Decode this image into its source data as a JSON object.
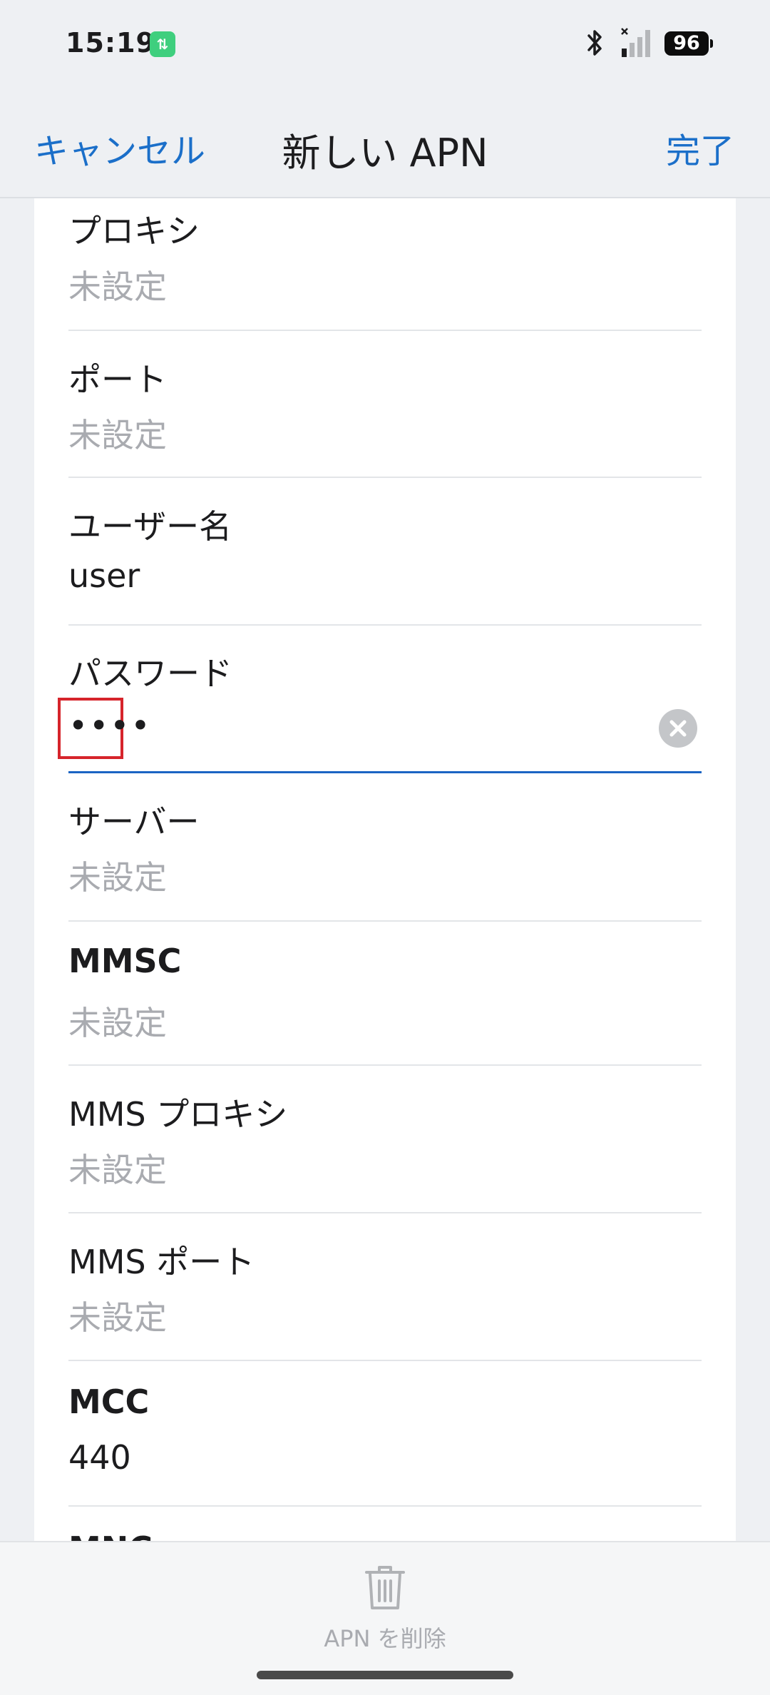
{
  "status_bar": {
    "time": "15:19",
    "network_badge": "⇅",
    "battery": "96"
  },
  "navbar": {
    "cancel_label": "キャンセル",
    "title": "新しい APN",
    "done_label": "完了"
  },
  "fields": [
    {
      "label": "プロキシ",
      "value": "未設定",
      "is_placeholder": true
    },
    {
      "label": "ポート",
      "value": "未設定",
      "is_placeholder": true
    },
    {
      "label": "ユーザー名",
      "value": "user",
      "is_placeholder": false
    },
    {
      "label": "パスワード",
      "value": "••••",
      "is_placeholder": false,
      "focused": true
    },
    {
      "label": "サーバー",
      "value": "未設定",
      "is_placeholder": true
    },
    {
      "label": "MMSC",
      "value": "未設定",
      "is_placeholder": true
    },
    {
      "label": "MMS プロキシ",
      "value": "未設定",
      "is_placeholder": true
    },
    {
      "label": "MMS ポート",
      "value": "未設定",
      "is_placeholder": true
    },
    {
      "label": "MCC",
      "value": "440",
      "is_placeholder": false
    },
    {
      "label": "MNC"
    }
  ],
  "bottom": {
    "delete_label": "APN を削除"
  },
  "colors": {
    "accent": "#1b6fc9",
    "placeholder": "#a9abb0",
    "focus_underline": "#1b64c3",
    "highlight_box": "#d6242b"
  }
}
